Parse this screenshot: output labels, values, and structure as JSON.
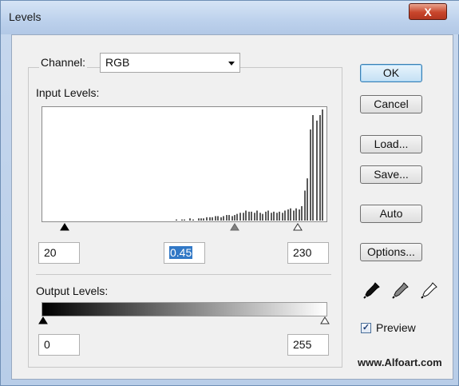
{
  "window": {
    "title": "Levels",
    "close_glyph": "X"
  },
  "channel": {
    "label": "Channel:",
    "value": "RGB"
  },
  "input_levels": {
    "label": "Input Levels:",
    "black": "20",
    "gamma": "0.45",
    "white": "230",
    "histogram_bars": [
      {
        "x": 0.47,
        "h": 0.01
      },
      {
        "x": 0.49,
        "h": 0.01
      },
      {
        "x": 0.5,
        "h": 0.01
      },
      {
        "x": 0.52,
        "h": 0.02
      },
      {
        "x": 0.53,
        "h": 0.01
      },
      {
        "x": 0.55,
        "h": 0.02
      },
      {
        "x": 0.56,
        "h": 0.02
      },
      {
        "x": 0.57,
        "h": 0.02
      },
      {
        "x": 0.58,
        "h": 0.03
      },
      {
        "x": 0.59,
        "h": 0.03
      },
      {
        "x": 0.6,
        "h": 0.03
      },
      {
        "x": 0.61,
        "h": 0.04
      },
      {
        "x": 0.62,
        "h": 0.04
      },
      {
        "x": 0.63,
        "h": 0.03
      },
      {
        "x": 0.64,
        "h": 0.04
      },
      {
        "x": 0.65,
        "h": 0.05
      },
      {
        "x": 0.66,
        "h": 0.05
      },
      {
        "x": 0.67,
        "h": 0.04
      },
      {
        "x": 0.68,
        "h": 0.05
      },
      {
        "x": 0.69,
        "h": 0.06
      },
      {
        "x": 0.7,
        "h": 0.07
      },
      {
        "x": 0.71,
        "h": 0.07
      },
      {
        "x": 0.72,
        "h": 0.09
      },
      {
        "x": 0.73,
        "h": 0.08
      },
      {
        "x": 0.74,
        "h": 0.08
      },
      {
        "x": 0.75,
        "h": 0.07
      },
      {
        "x": 0.76,
        "h": 0.09
      },
      {
        "x": 0.77,
        "h": 0.07
      },
      {
        "x": 0.78,
        "h": 0.06
      },
      {
        "x": 0.79,
        "h": 0.08
      },
      {
        "x": 0.8,
        "h": 0.09
      },
      {
        "x": 0.81,
        "h": 0.07
      },
      {
        "x": 0.82,
        "h": 0.08
      },
      {
        "x": 0.83,
        "h": 0.07
      },
      {
        "x": 0.84,
        "h": 0.08
      },
      {
        "x": 0.85,
        "h": 0.07
      },
      {
        "x": 0.86,
        "h": 0.09
      },
      {
        "x": 0.87,
        "h": 0.1
      },
      {
        "x": 0.88,
        "h": 0.11
      },
      {
        "x": 0.89,
        "h": 0.09
      },
      {
        "x": 0.9,
        "h": 0.11
      },
      {
        "x": 0.91,
        "h": 0.1
      },
      {
        "x": 0.92,
        "h": 0.13
      },
      {
        "x": 0.93,
        "h": 0.27
      },
      {
        "x": 0.94,
        "h": 0.38
      },
      {
        "x": 0.95,
        "h": 0.82
      },
      {
        "x": 0.96,
        "h": 0.95
      },
      {
        "x": 0.975,
        "h": 0.9
      },
      {
        "x": 0.985,
        "h": 0.95
      },
      {
        "x": 0.995,
        "h": 1.0
      }
    ]
  },
  "output_levels": {
    "label": "Output Levels:",
    "black": "0",
    "white": "255"
  },
  "buttons": {
    "ok": "OK",
    "cancel": "Cancel",
    "load": "Load...",
    "save": "Save...",
    "auto": "Auto",
    "options": "Options..."
  },
  "preview": {
    "label": "Preview",
    "checked": true,
    "check_glyph": "✓"
  },
  "watermark": "www.Alfoart.com"
}
